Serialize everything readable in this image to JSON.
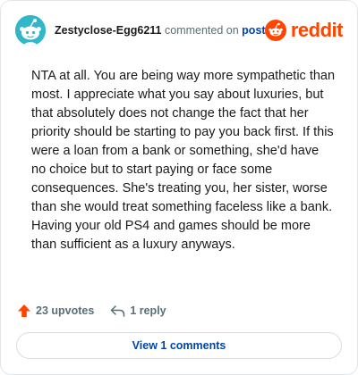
{
  "comment": {
    "username": "Zestyclose-Egg6211",
    "action_text": "commented on",
    "post_link": "post",
    "body": "NTA at all. You are being way more sympathetic than most. I appreciate what you say about luxuries, but that absolutely does not change the fact that her priority should be starting to pay you back first. If this were a loan from a bank or something, she'd have no choice but to start paying or face some consequences. She's treating you, her sister, worse than she would treat something faceless like a bank. Having your old PS4 and games should be more than sufficient as a luxury anyways."
  },
  "brand": {
    "wordmark": "reddit",
    "color": "#ff4500",
    "icon": "reddit-snoo-icon"
  },
  "actions": {
    "upvotes_label": "23 upvotes",
    "upvote_icon": "upvote-arrow-icon",
    "replies_label": "1 reply",
    "reply_icon": "reply-arrow-icon"
  },
  "view_button": {
    "label": "View 1 comments"
  },
  "colors": {
    "accent_orange": "#ff4500",
    "link_blue": "#0045ac",
    "avatar_bg": "#32b6c9",
    "muted_text": "#576f76"
  }
}
